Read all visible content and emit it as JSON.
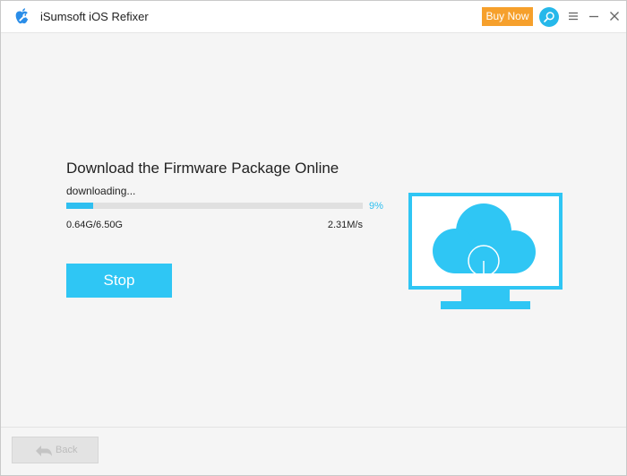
{
  "app": {
    "title": "iSumsoft iOS Refixer",
    "logo_icon": "apple-wrench-icon"
  },
  "header": {
    "buy_label": "Buy Now",
    "search_icon": "search-icon",
    "menu_icon": "menu-icon",
    "minimize_icon": "minimize-icon",
    "close_icon": "close-icon"
  },
  "download": {
    "heading": "Download the Firmware Package Online",
    "status": "downloading...",
    "progress_percent": 9,
    "percent_label": "9%",
    "size_text": "0.64G/6.50G",
    "speed_text": "2.31M/s",
    "stop_label": "Stop"
  },
  "illustration": {
    "icon": "cloud-monitor-icon"
  },
  "footer": {
    "back_label": "Back",
    "back_icon": "back-arrow-icon"
  },
  "colors": {
    "accent": "#2fc6f4",
    "buy": "#f6a02c",
    "background": "#f5f5f5"
  }
}
